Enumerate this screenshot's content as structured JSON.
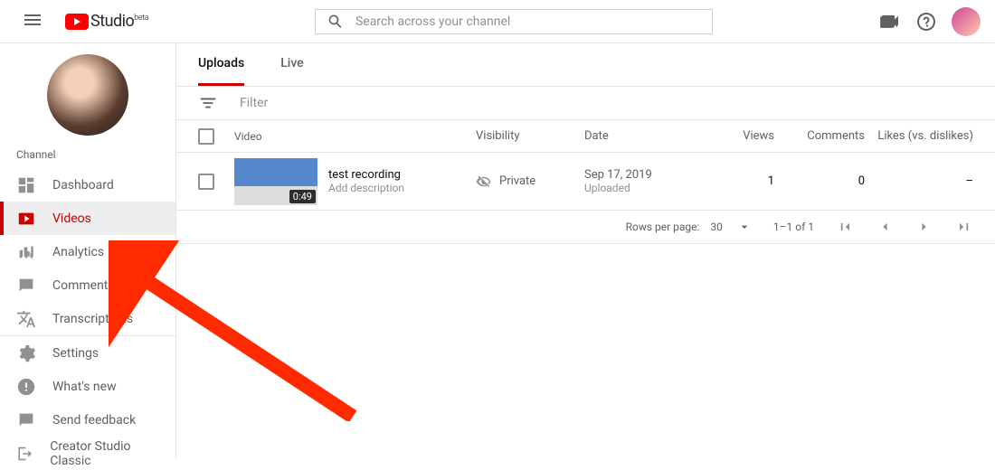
{
  "header": {
    "logo_text": "Studio",
    "logo_beta": "beta",
    "search_placeholder": "Search across your channel"
  },
  "sidebar": {
    "channel_label": "Channel",
    "items": [
      {
        "key": "dashboard",
        "label": "Dashboard"
      },
      {
        "key": "videos",
        "label": "Videos"
      },
      {
        "key": "analytics",
        "label": "Analytics"
      },
      {
        "key": "comments",
        "label": "Comments"
      },
      {
        "key": "transcriptions",
        "label": "Transcriptions"
      }
    ],
    "footer_items": [
      {
        "key": "settings",
        "label": "Settings"
      },
      {
        "key": "whats_new",
        "label": "What's new"
      },
      {
        "key": "send_feedback",
        "label": "Send feedback"
      },
      {
        "key": "classic",
        "label": "Creator Studio Classic"
      }
    ],
    "selected": "videos"
  },
  "tabs": {
    "items": [
      {
        "key": "uploads",
        "label": "Uploads"
      },
      {
        "key": "live",
        "label": "Live"
      }
    ],
    "active": "uploads"
  },
  "filter": {
    "placeholder": "Filter"
  },
  "table": {
    "headers": {
      "video": "Video",
      "visibility": "Visibility",
      "date": "Date",
      "views": "Views",
      "comments": "Comments",
      "likes": "Likes (vs. dislikes)"
    },
    "rows": [
      {
        "title": "test recording",
        "description": "Add description",
        "duration": "0:49",
        "visibility": "Private",
        "date": "Sep 17, 2019",
        "date_sub": "Uploaded",
        "views": "1",
        "comments": "0",
        "likes": "–"
      }
    ]
  },
  "pagination": {
    "rows_label": "Rows per page:",
    "rows_value": "30",
    "range": "1–1 of 1"
  }
}
